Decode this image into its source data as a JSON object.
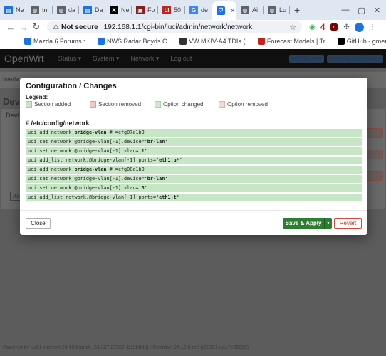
{
  "browser": {
    "tabs": [
      {
        "label": "Ne",
        "favicon": "doc-icon",
        "color": "#1a73e8",
        "glyph": "▤"
      },
      {
        "label": "tnl",
        "favicon": "globe-icon",
        "color": "#5f6368",
        "glyph": "◍"
      },
      {
        "label": "da",
        "favicon": "globe-icon",
        "color": "#5f6368",
        "glyph": "◍"
      },
      {
        "label": "Da",
        "favicon": "doc-icon",
        "color": "#1a73e8",
        "glyph": "▤"
      },
      {
        "label": "Ne",
        "favicon": "x-icon",
        "color": "#000000",
        "glyph": "X"
      },
      {
        "label": "Fo",
        "favicon": "forum-icon",
        "color": "#8b1a1a",
        "glyph": "▣"
      },
      {
        "label": "50",
        "favicon": "li-icon",
        "color": "#c5221f",
        "glyph": "LI"
      },
      {
        "label": "de",
        "favicon": "google-icon",
        "color": "#4285f4",
        "glyph": "G"
      },
      {
        "label": "",
        "favicon": "openwrt-icon",
        "color": "#1a73e8",
        "glyph": "⛉",
        "active": true
      },
      {
        "label": "Ai",
        "favicon": "globe-icon",
        "color": "#5f6368",
        "glyph": "◍"
      },
      {
        "label": "Lo",
        "favicon": "globe-icon",
        "color": "#5f6368",
        "glyph": "◍"
      }
    ],
    "new_tab": "+",
    "window_controls": [
      "—",
      "▢",
      "✕"
    ],
    "address": {
      "security_label": "Not secure",
      "url": "192.168.1.1/cgi-bin/luci/admin/network/network"
    },
    "extensions": {
      "badge_count": "4",
      "ublock": "u",
      "profile": "👤"
    },
    "bookmarks": [
      {
        "label": "Mazda 6 Forums :...",
        "color": "#1a73e8"
      },
      {
        "label": "NWS Radar Boyds C...",
        "color": "#1a73e8"
      },
      {
        "label": "VW MKIV-A4 TDIs (...",
        "color": "#333333"
      },
      {
        "label": "Forecast Models | Tr...",
        "color": "#c5221f"
      },
      {
        "label": "GitHub - gmenouno...",
        "color": "#000000"
      }
    ]
  },
  "openwrt": {
    "brand": "OpenWrt",
    "menu": [
      "Status ▾",
      "System ▾",
      "Network ▾",
      "Log out"
    ],
    "status_pills": [
      "REFRESHING",
      "UNSAVED CHANGES: 8"
    ],
    "bg_tab": "Interfa",
    "bg_heading": "Devi",
    "bg_subheading": "Devi",
    "bg_add": "Add",
    "footer": "Powered by LuCI openwrt-24.10 branch (24.337.27339~b1968d9) / OpenWrt 24.10.0-rc2 (r28161-ea17e958b9)"
  },
  "modal": {
    "title": "Configuration / Changes",
    "legend_label": "Legend:",
    "legend": [
      {
        "label": "Section added",
        "color": "#c6e6c6",
        "border": "#9ccf9c"
      },
      {
        "label": "Section removed",
        "color": "#f6c9c2",
        "border": "#e49a8e"
      },
      {
        "label": "Option changed",
        "color": "#cfe8cf",
        "border": "#a8d4a8"
      },
      {
        "label": "Option removed",
        "color": "#f8d8d2",
        "border": "#e8b0a6"
      }
    ],
    "file_title": "# /etc/config/network",
    "lines": [
      {
        "pre": "uci add network ",
        "bold": "bridge-vlan",
        "post": " # =cfg07a1b0"
      },
      {
        "pre": "uci set network.@bridge-vlan[-1].device=",
        "bold": "'br-lan'",
        "post": ""
      },
      {
        "pre": "uci set network.@bridge-vlan[-1].vlan=",
        "bold": "'1'",
        "post": ""
      },
      {
        "pre": "uci add_list network.@bridge-vlan[-1].ports=",
        "bold": "'eth1:u*'",
        "post": ""
      },
      {
        "pre": "uci add network ",
        "bold": "bridge-vlan",
        "post": " # =cfg08a1b0"
      },
      {
        "pre": "uci set network.@bridge-vlan[-1].device=",
        "bold": "'br-lan'",
        "post": ""
      },
      {
        "pre": "uci set network.@bridge-vlan[-1].vlan=",
        "bold": "'3'",
        "post": ""
      },
      {
        "pre": "uci add_list network.@bridge-vlan[-1].ports=",
        "bold": "'eth1:t'",
        "post": ""
      }
    ],
    "buttons": {
      "close": "Close",
      "save_apply": "Save & Apply",
      "dropdown": "▾",
      "revert": "Revert"
    }
  }
}
